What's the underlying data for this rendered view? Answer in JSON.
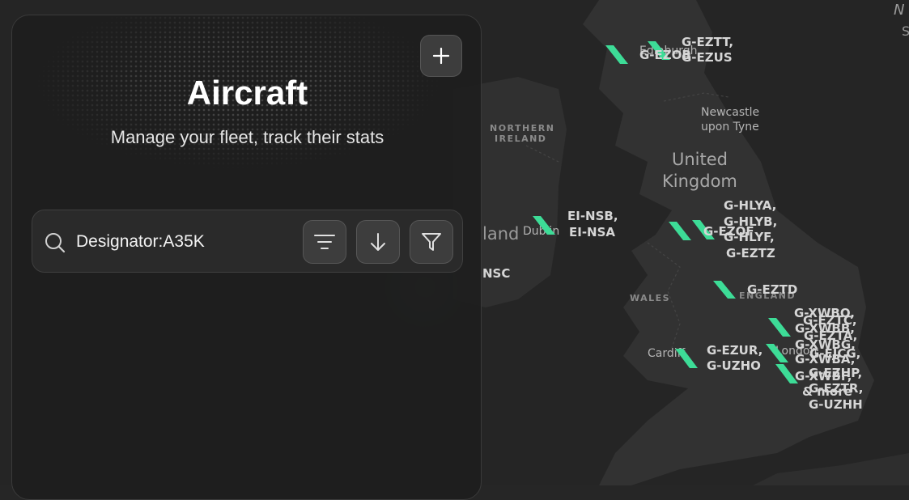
{
  "panel": {
    "title": "Aircraft",
    "subtitle": "Manage your fleet, track their stats",
    "add_icon": "plus-icon",
    "search": {
      "value": "Designator:A35K",
      "icon": "search-icon"
    },
    "tools": {
      "sort_icon": "sort-lines-icon",
      "direction_icon": "arrow-down-icon",
      "filter_icon": "funnel-icon"
    }
  },
  "map": {
    "regions": [
      "NORTHERN",
      "IRELAND",
      "WALES",
      "ENGLAND"
    ],
    "country": [
      "United",
      "Kingdom"
    ],
    "cities": [
      "Edinburgh",
      "Newcastle",
      "upon Tyne",
      "Dublin",
      "Cardiff",
      "London"
    ],
    "partial": [
      "land",
      "NSC"
    ],
    "aircraft_groups": [
      {
        "lines": [
          "G-EZTT,",
          "G-EZUS"
        ]
      },
      {
        "lines": [
          "G-EZOB"
        ]
      },
      {
        "lines": [
          "EI-NSB,",
          "EI-NSA"
        ]
      },
      {
        "lines": [
          "G-HLYA,",
          "G-HLYB,",
          "G-HLYF,",
          "G-EZTZ"
        ]
      },
      {
        "lines": [
          "G-EZOF"
        ]
      },
      {
        "lines": [
          "G-EZTD"
        ]
      },
      {
        "lines": [
          "G-XWBO,",
          "G-EZTC,",
          "G-XWBB,",
          "G-EZTA,",
          "G-XWBG,",
          "G-XWBA,",
          "G-EJCG,",
          "G-EZHP,",
          "G-XWBF,",
          "& more",
          "G-EZTR,",
          "G-UZHH"
        ]
      },
      {
        "lines": [
          "G-EZUR,",
          "G-UZHO"
        ]
      }
    ]
  },
  "colors": {
    "accent_green": "#3ddc97",
    "map_land": "#2f2f2f",
    "map_sea": "#262626"
  }
}
